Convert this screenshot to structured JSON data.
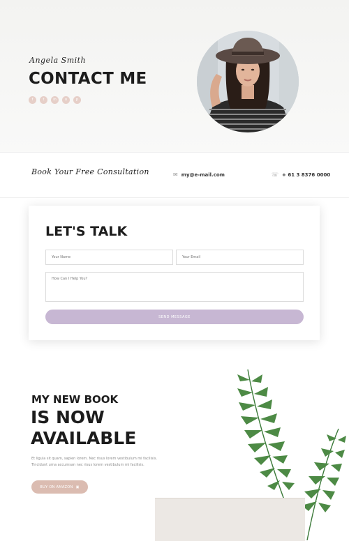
{
  "hero": {
    "signature": "Angela Smith",
    "title": "CONTACT ME",
    "social_icons": [
      {
        "name": "facebook-icon",
        "glyph": "f"
      },
      {
        "name": "twitter-icon",
        "glyph": "t"
      },
      {
        "name": "linkedin-icon",
        "glyph": "in"
      },
      {
        "name": "instagram-icon",
        "glyph": "o"
      },
      {
        "name": "pinterest-icon",
        "glyph": "p"
      }
    ]
  },
  "consult": {
    "title": "Book Your Free Consultation",
    "email": "my@e-mail.com",
    "phone": "+ 61 3 8376 0000",
    "email_icon": "mail-icon",
    "phone_icon": "phone-icon"
  },
  "form": {
    "title": "LET'S TALK",
    "name_placeholder": "Your Name",
    "email_placeholder": "Your Email",
    "message_placeholder": "How Can I Help You?",
    "submit_label": "SEND MESSAGE"
  },
  "book": {
    "kicker": "MY NEW BOOK",
    "headline": "IS NOW AVAILABLE",
    "description": "Et ligula sit quam, sapien lorem. Nec risus lorem vestibulum mi facilisis. Tincidunt urna accumsan nec risus lorem vestibulum mi facilisis.",
    "button_label": "BUY ON AMAZON",
    "button_icon": "shopping-bag-icon"
  },
  "colors": {
    "accent_lavender": "#c7b7d3",
    "accent_blush": "#dbbcb1",
    "social_dot": "#e6cfc8"
  }
}
